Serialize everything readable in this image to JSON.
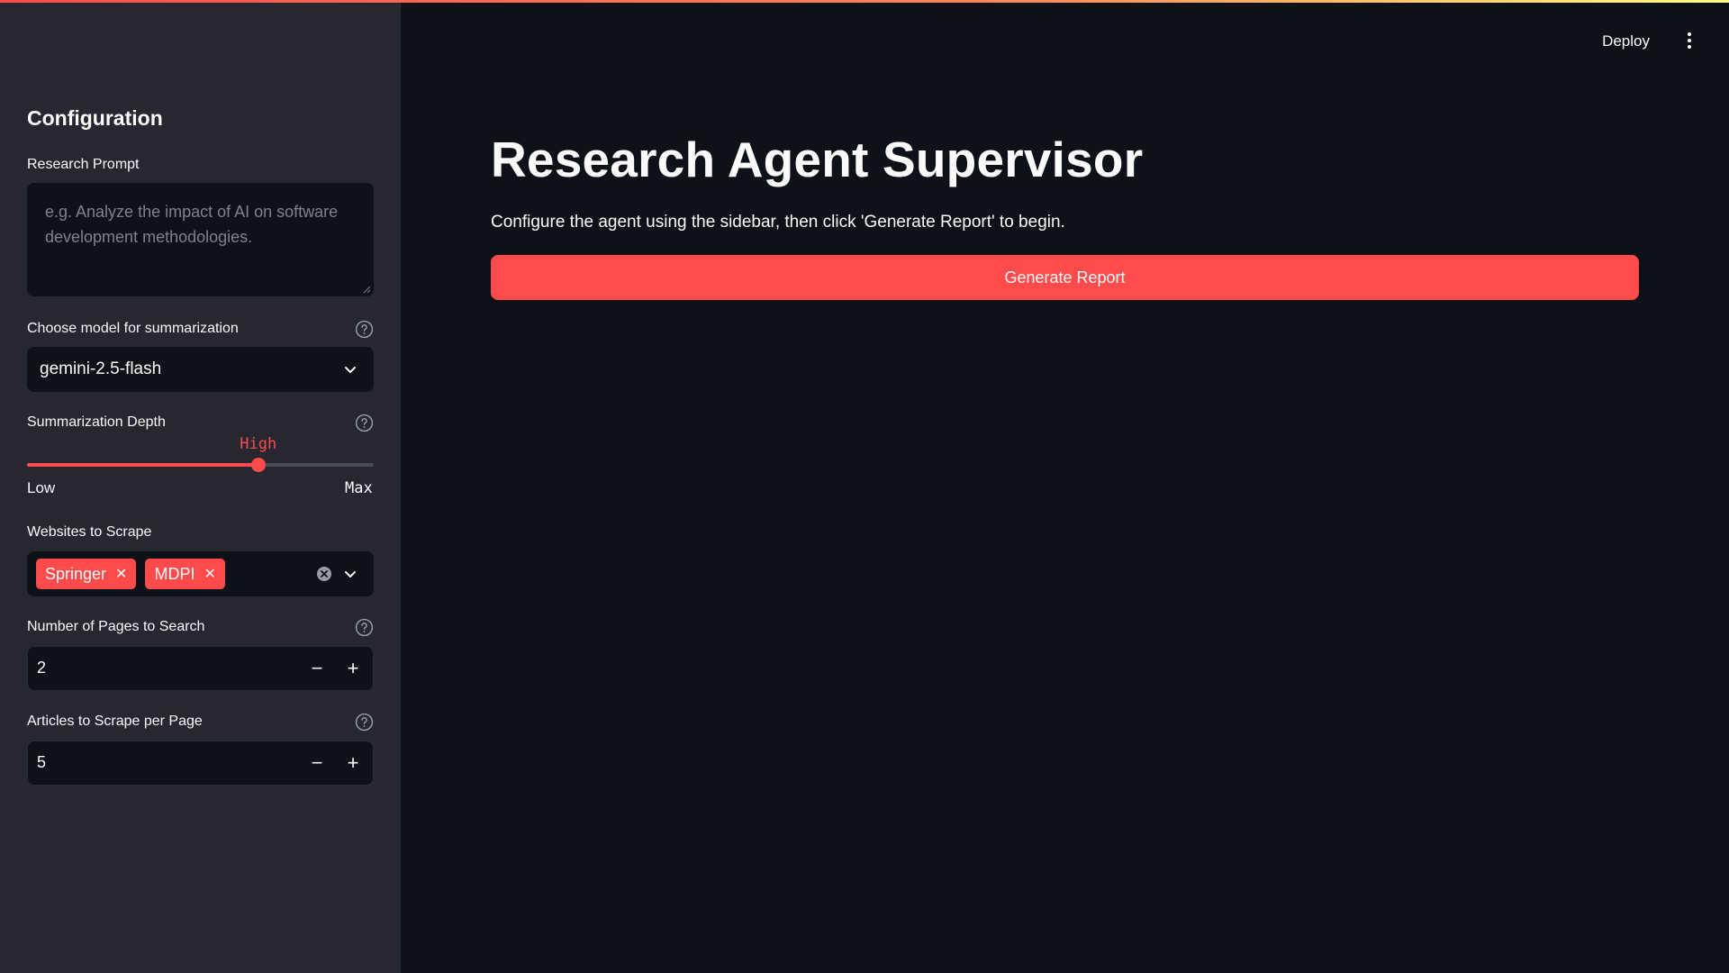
{
  "header": {
    "deploy_label": "Deploy",
    "menu_icon": "kebab-menu-icon"
  },
  "sidebar": {
    "title": "Configuration",
    "research_prompt": {
      "label": "Research Prompt",
      "placeholder": "e.g. Analyze the impact of AI on software development methodologies.",
      "value": ""
    },
    "model": {
      "label": "Choose model for summarization",
      "selected": "gemini-2.5-flash"
    },
    "depth": {
      "label": "Summarization Depth",
      "value_label": "High",
      "min_label": "Low",
      "max_label": "Max",
      "fraction": 0.667
    },
    "websites": {
      "label": "Websites to Scrape",
      "selected": [
        "Springer",
        "MDPI"
      ]
    },
    "pages": {
      "label": "Number of Pages to Search",
      "value": "2"
    },
    "articles": {
      "label": "Articles to Scrape per Page",
      "value": "5"
    }
  },
  "main": {
    "title": "Research Agent Supervisor",
    "intro": "Configure the agent using the sidebar, then click 'Generate Report' to begin.",
    "button_label": "Generate Report"
  },
  "colors": {
    "accent": "#ff4b4b",
    "background": "#0e1117",
    "sidebar": "#262730"
  }
}
